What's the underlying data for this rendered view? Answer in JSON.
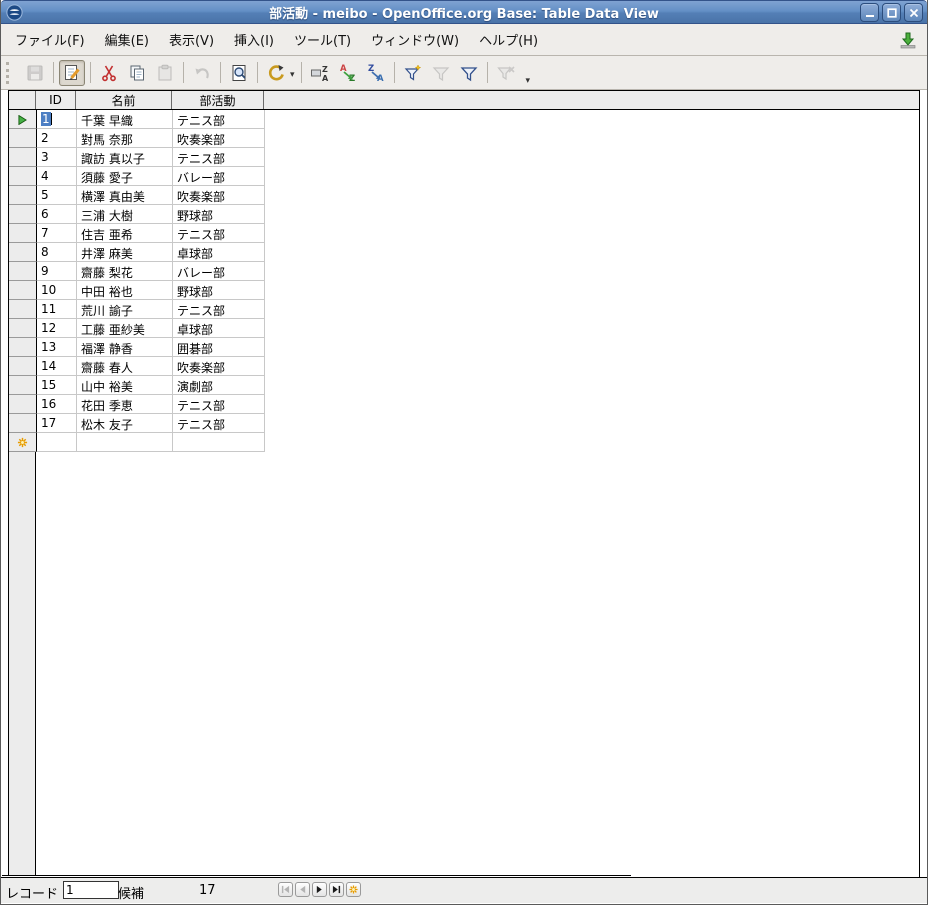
{
  "titlebar": {
    "title": "部活動 - meibo - OpenOffice.org Base: Table Data View",
    "buttons": [
      "minimize",
      "maximize",
      "close"
    ]
  },
  "menubar": {
    "items": [
      "ファイル(F)",
      "編集(E)",
      "表示(V)",
      "挿入(I)",
      "ツール(T)",
      "ウィンドウ(W)",
      "ヘルプ(H)"
    ],
    "right_icon": "update-download-icon"
  },
  "toolbar": {
    "buttons": [
      {
        "icon": "save-icon",
        "name": "save",
        "enabled": false
      },
      {
        "icon": "edit-data-icon",
        "name": "edit-data",
        "enabled": true,
        "active": true
      },
      {
        "icon": "cut-icon",
        "name": "cut",
        "enabled": true
      },
      {
        "icon": "copy-icon",
        "name": "copy",
        "enabled": true
      },
      {
        "icon": "paste-icon",
        "name": "paste",
        "enabled": false
      },
      {
        "icon": "undo-icon",
        "name": "undo",
        "enabled": false
      },
      {
        "icon": "find-record-icon",
        "name": "find-record",
        "enabled": true
      },
      {
        "icon": "refresh-icon",
        "name": "refresh",
        "enabled": true,
        "has_dropdown": true
      },
      {
        "icon": "sort-icon",
        "name": "sort",
        "enabled": true
      },
      {
        "icon": "sort-ascending-icon",
        "name": "sort-ascending",
        "enabled": true
      },
      {
        "icon": "sort-descending-icon",
        "name": "sort-descending",
        "enabled": true
      },
      {
        "icon": "auto-filter-icon",
        "name": "auto-filter",
        "enabled": true
      },
      {
        "icon": "apply-filter-icon",
        "name": "apply-filter",
        "enabled": false
      },
      {
        "icon": "standard-filter-icon",
        "name": "standard-filter",
        "enabled": true
      },
      {
        "icon": "remove-filter-icon",
        "name": "remove-filter",
        "enabled": false
      }
    ]
  },
  "table": {
    "columns": [
      "ID",
      "名前",
      "部活動"
    ],
    "current_row_index": 0,
    "rows": [
      {
        "id": "1",
        "name": "千葉 早織",
        "club": "テニス部"
      },
      {
        "id": "2",
        "name": "對馬 奈那",
        "club": "吹奏楽部"
      },
      {
        "id": "3",
        "name": "諏訪 真以子",
        "club": "テニス部"
      },
      {
        "id": "4",
        "name": "須藤 愛子",
        "club": "バレー部"
      },
      {
        "id": "5",
        "name": "横澤 真由美",
        "club": "吹奏楽部"
      },
      {
        "id": "6",
        "name": "三浦 大樹",
        "club": "野球部"
      },
      {
        "id": "7",
        "name": "住吉 亜希",
        "club": "テニス部"
      },
      {
        "id": "8",
        "name": "井澤 麻美",
        "club": "卓球部"
      },
      {
        "id": "9",
        "name": "齋藤 梨花",
        "club": "バレー部"
      },
      {
        "id": "10",
        "name": "中田 裕也",
        "club": "野球部"
      },
      {
        "id": "11",
        "name": "荒川 諭子",
        "club": "テニス部"
      },
      {
        "id": "12",
        "name": "工藤 亜紗美",
        "club": "卓球部"
      },
      {
        "id": "13",
        "name": "福澤 静香",
        "club": "囲碁部"
      },
      {
        "id": "14",
        "name": "齋藤 春人",
        "club": "吹奏楽部"
      },
      {
        "id": "15",
        "name": "山中 裕美",
        "club": "演劇部"
      },
      {
        "id": "16",
        "name": "花田 季恵",
        "club": "テニス部"
      },
      {
        "id": "17",
        "name": "松木 友子",
        "club": "テニス部"
      }
    ]
  },
  "record_bar": {
    "record_label": "レコード",
    "record_value": "1",
    "of_label": "候補",
    "total_records": "17",
    "nav_icons": [
      "first-record-icon",
      "previous-record-icon",
      "next-record-icon",
      "last-record-icon",
      "new-record-icon"
    ]
  }
}
